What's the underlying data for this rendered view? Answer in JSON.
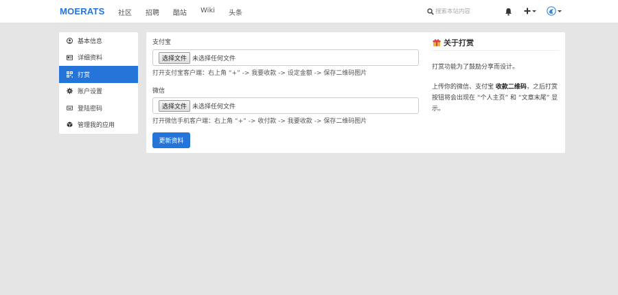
{
  "brand": "MOERATS",
  "nav": [
    "社区",
    "招聘",
    "酷站",
    "Wiki",
    "头条"
  ],
  "search": {
    "placeholder": "搜索本站内容"
  },
  "sidebar": {
    "items": [
      {
        "label": "基本信息",
        "icon": "user-circle-icon"
      },
      {
        "label": "详细资料",
        "icon": "id-card-icon"
      },
      {
        "label": "打赏",
        "icon": "qrcode-icon",
        "active": true
      },
      {
        "label": "账户设置",
        "icon": "gear-icon"
      },
      {
        "label": "登陆密码",
        "icon": "keyboard-icon"
      },
      {
        "label": "管理我的应用",
        "icon": "cube-icon"
      }
    ]
  },
  "form": {
    "alipay": {
      "label": "支付宝",
      "button": "选择文件",
      "status": "未选择任何文件",
      "hint": "打开支付宝客户端：右上角 “+” -> 我要收款 -> 设定金额 -> 保存二维码图片"
    },
    "wechat": {
      "label": "微信",
      "button": "选择文件",
      "status": "未选择任何文件",
      "hint": "打开微信手机客户端：右上角 “+” -> 收付款 -> 我要收款 -> 保存二维码图片"
    },
    "submit": "更新资料"
  },
  "about": {
    "title": "关于打赏",
    "p1": "打赏功能为了鼓励分享而设计。",
    "p2_pre": "上传你的微信、支付宝 ",
    "p2_bold": "收款二维码",
    "p2_post": "，之后打赏按钮将会出现在 “个人主页” 和 “文章末尾” 显示。"
  },
  "colors": {
    "accent": "#2574d9",
    "background": "#e5e5e5"
  }
}
